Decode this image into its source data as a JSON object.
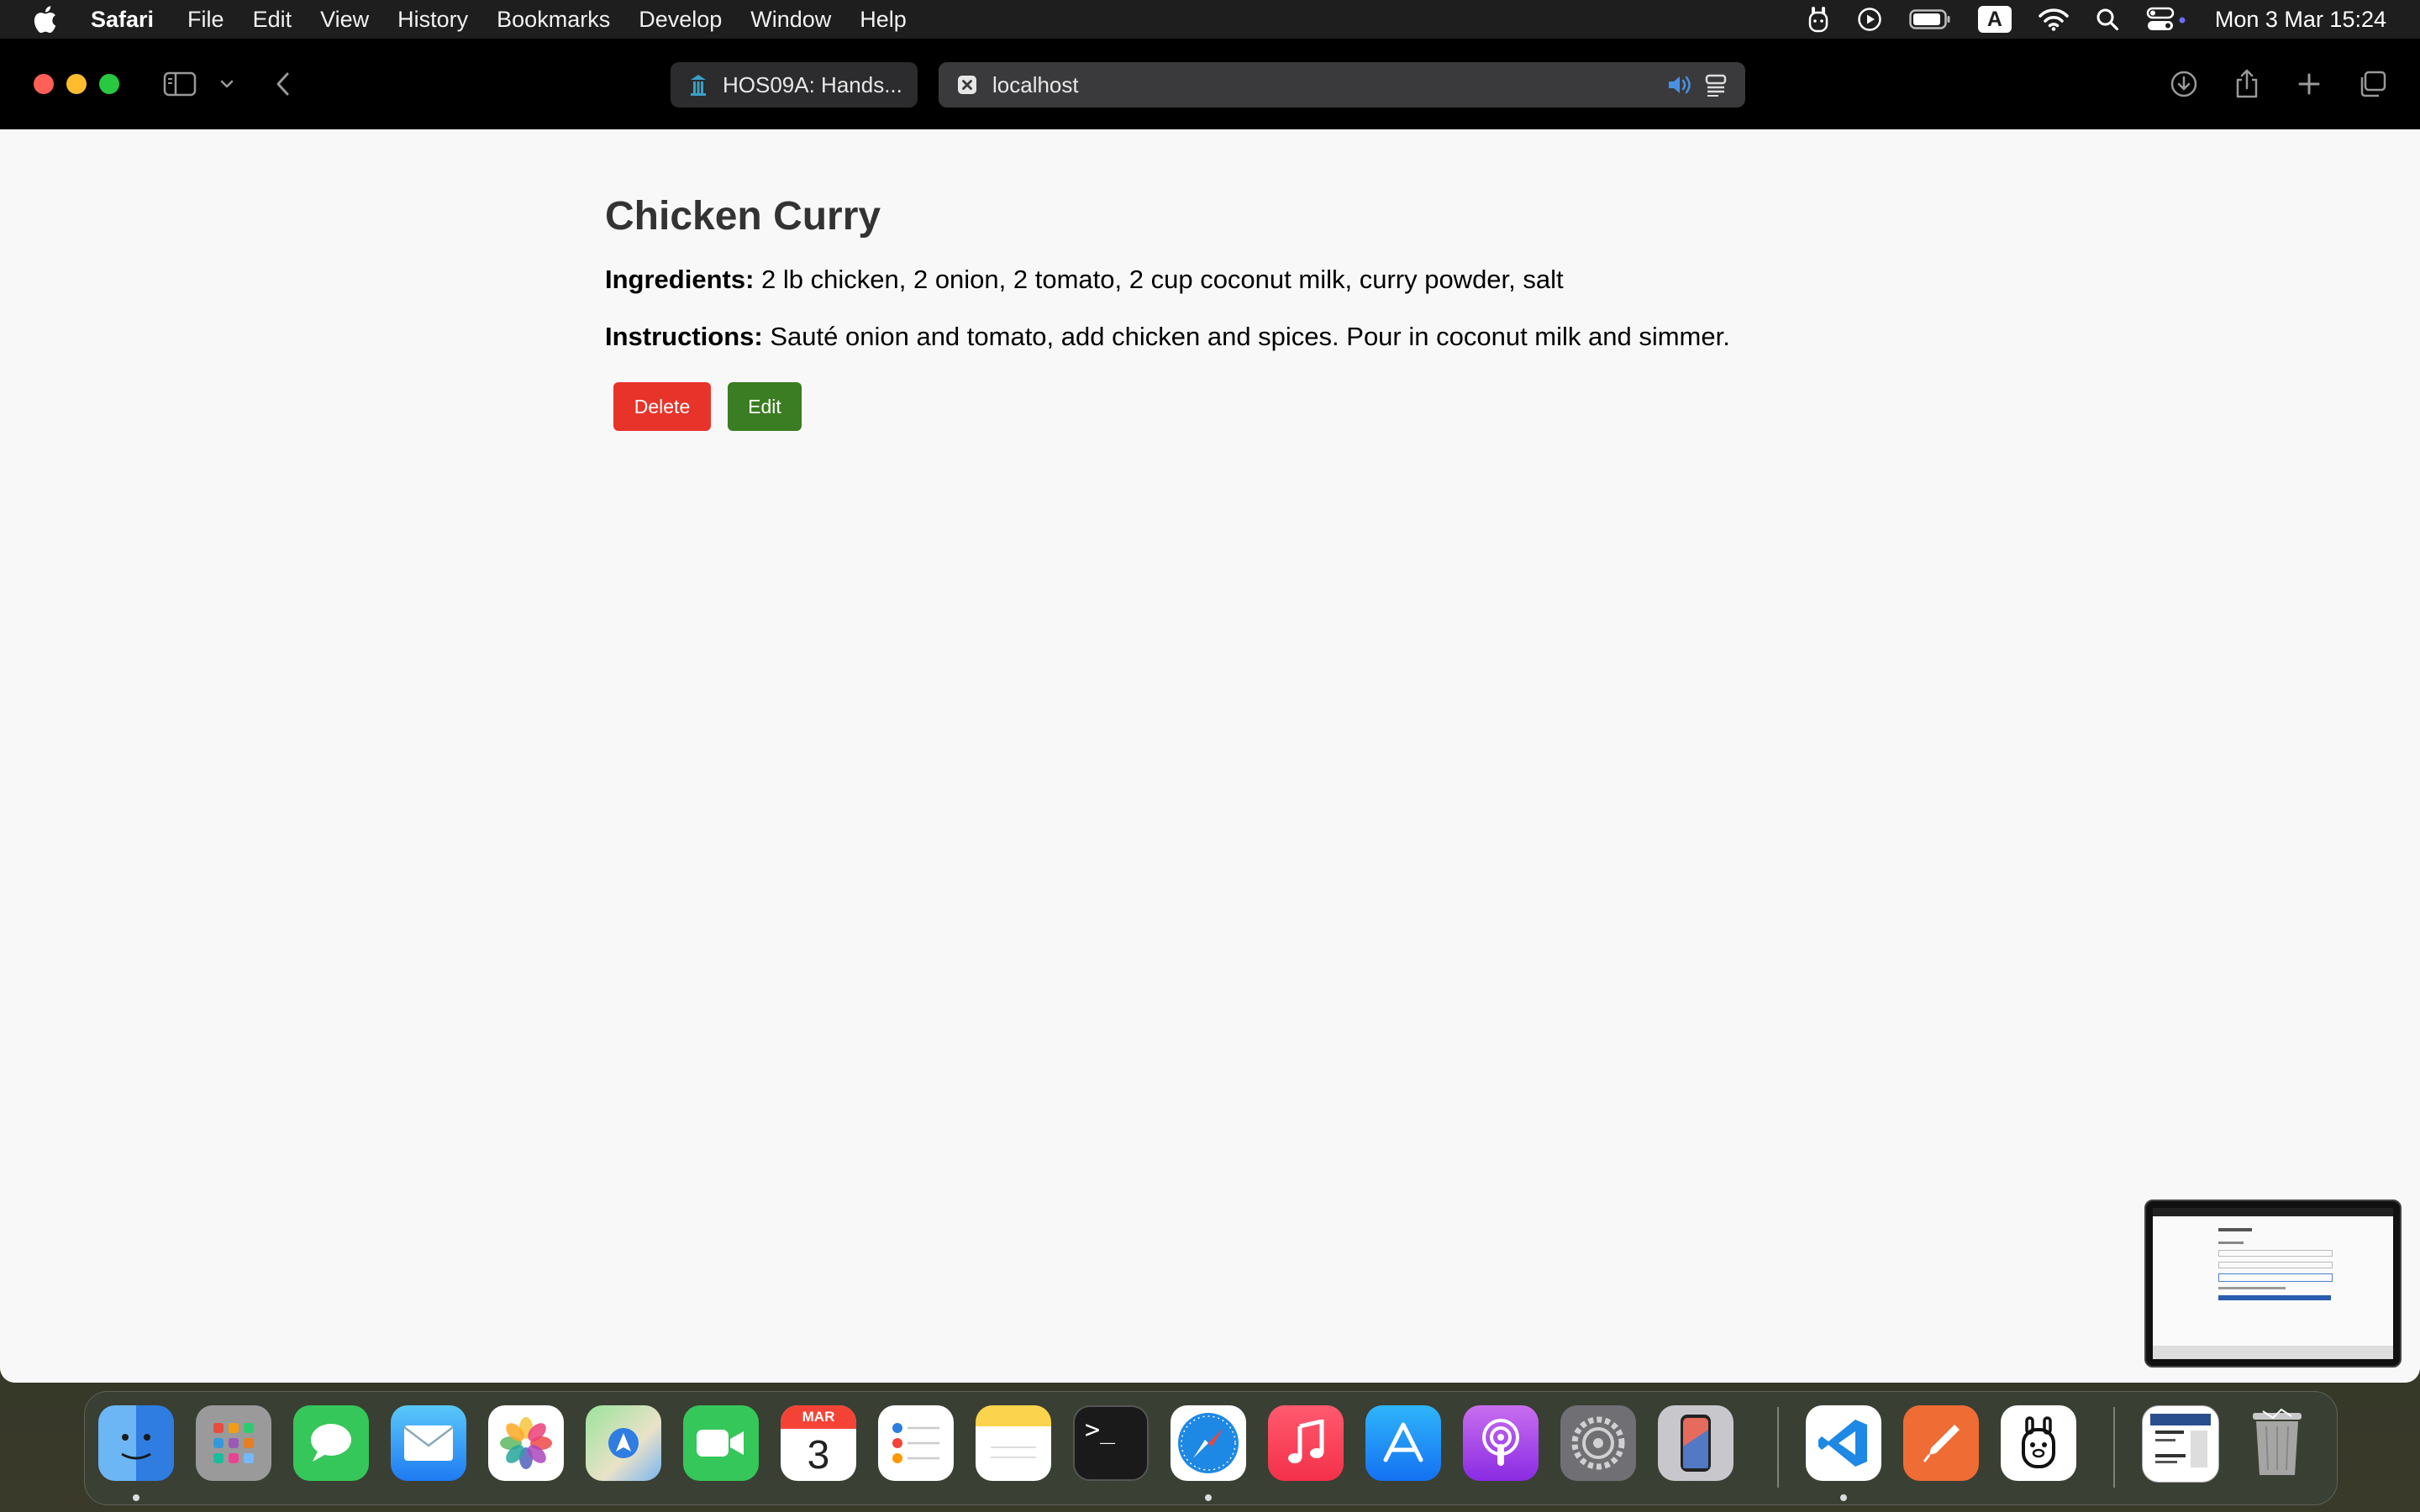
{
  "menubar": {
    "app_name": "Safari",
    "items": [
      "File",
      "Edit",
      "View",
      "History",
      "Bookmarks",
      "Develop",
      "Window",
      "Help"
    ],
    "keyboard_indicator": "A",
    "clock": "Mon 3 Mar  15:24"
  },
  "browser": {
    "tabs": [
      {
        "label": "HOS09A: Hands...",
        "icon": "tab-favicon-icon"
      },
      {
        "label": "localhost",
        "icon": "close-tab-icon"
      }
    ]
  },
  "page": {
    "title": "Chicken Curry",
    "ingredients_label": "Ingredients:",
    "ingredients_text": "2 lb chicken, 2 onion, 2 tomato, 2 cup coconut milk, curry powder, salt",
    "instructions_label": "Instructions:",
    "instructions_text": "Sauté onion and tomato, add chicken and spices. Pour in coconut milk and simmer.",
    "delete_label": "Delete",
    "edit_label": "Edit"
  },
  "dock": {
    "apps": [
      "Finder",
      "Launchpad",
      "Messages",
      "Mail",
      "Photos",
      "Maps",
      "FaceTime",
      "Calendar",
      "Reminders",
      "Notes",
      "Terminal",
      "Safari",
      "Music",
      "App Store",
      "Podcasts",
      "System Settings",
      "iPhone Mirroring",
      "Visual Studio Code",
      "Postman",
      "Ollama",
      "Document",
      "Trash"
    ],
    "calendar_month": "MAR",
    "calendar_day": "3",
    "terminal_glyph": ">_"
  },
  "colors": {
    "delete": "#e8332a",
    "edit": "#3a7d22",
    "page_bg": "#f8f8f8"
  }
}
